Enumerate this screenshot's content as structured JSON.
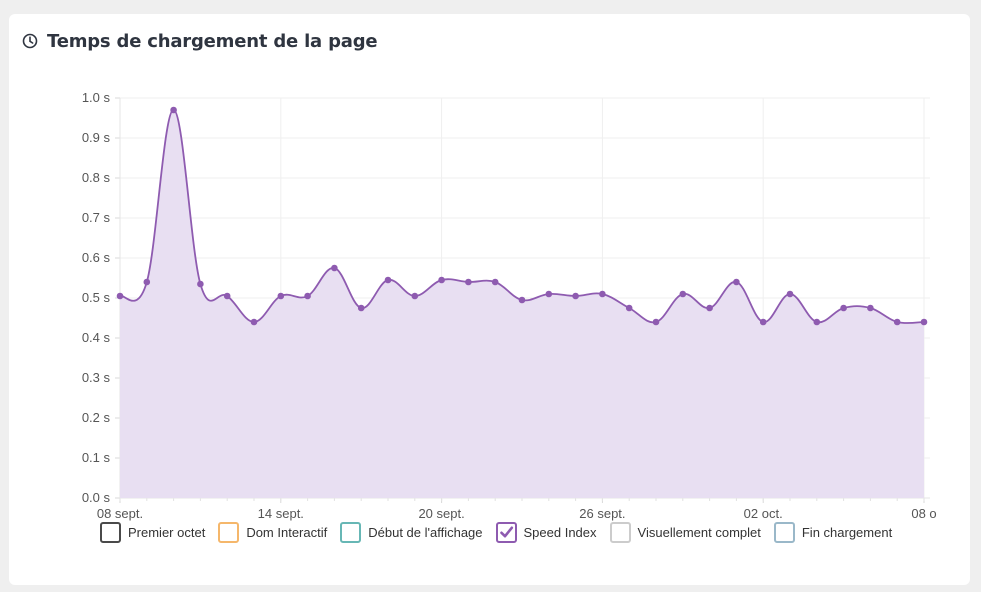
{
  "header": {
    "title": "Temps de chargement de la page",
    "icon": "clock-icon"
  },
  "legend": [
    {
      "label": "Premier octet",
      "color": "#4a4a4a",
      "checked": false
    },
    {
      "label": "Dom Interactif",
      "color": "#f5b76b",
      "checked": false
    },
    {
      "label": "Début de l'affichage",
      "color": "#67b7b5",
      "checked": false
    },
    {
      "label": "Speed Index",
      "color": "#8e5bb0",
      "checked": true
    },
    {
      "label": "Visuellement complet",
      "color": "#cccccc",
      "checked": false
    },
    {
      "label": "Fin chargement",
      "color": "#9ab8c9",
      "checked": false
    }
  ],
  "chart_data": {
    "type": "area",
    "title": "",
    "xlabel": "",
    "ylabel": "",
    "ylim": [
      0,
      1.0
    ],
    "y_ticks": [
      "0.0 s",
      "0.1 s",
      "0.2 s",
      "0.3 s",
      "0.4 s",
      "0.5 s",
      "0.6 s",
      "0.7 s",
      "0.8 s",
      "0.9 s",
      "1.0 s"
    ],
    "x_ticks": [
      {
        "label": "08 sept.",
        "index": 0
      },
      {
        "label": "14 sept.",
        "index": 6
      },
      {
        "label": "20 sept.",
        "index": 12
      },
      {
        "label": "26 sept.",
        "index": 18
      },
      {
        "label": "02 oct.",
        "index": 24
      },
      {
        "label": "08 o",
        "index": 30
      }
    ],
    "grid": true,
    "series": [
      {
        "color": "#8e5bb0",
        "fill": "#e8dff2",
        "values": [
          0.505,
          0.54,
          0.97,
          0.535,
          0.505,
          0.44,
          0.505,
          0.505,
          0.575,
          0.475,
          0.545,
          0.505,
          0.545,
          0.54,
          0.54,
          0.495,
          0.51,
          0.505,
          0.51,
          0.475,
          0.44,
          0.51,
          0.475,
          0.54,
          0.44,
          0.51,
          0.44,
          0.475,
          0.475,
          0.44,
          0.44
        ]
      }
    ]
  }
}
